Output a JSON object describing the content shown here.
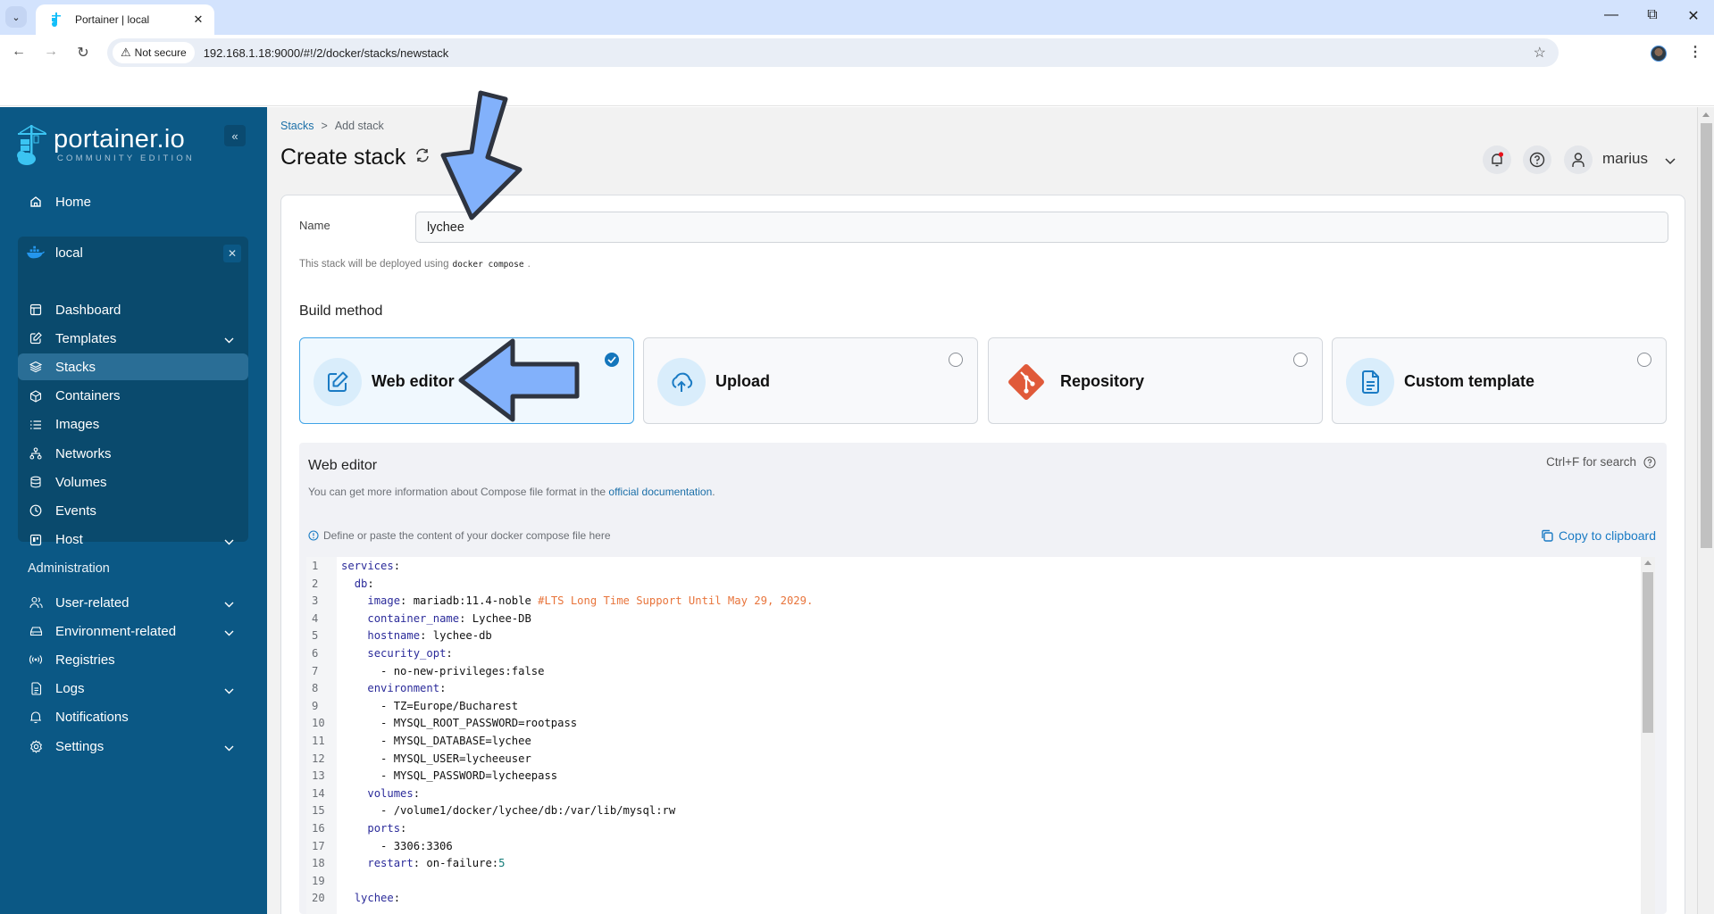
{
  "browser": {
    "tab_title": "Portainer | local",
    "security_label": "Not secure",
    "url": "192.168.1.18:9000/#!/2/docker/stacks/newstack"
  },
  "sidebar": {
    "logo_title": "portainer.io",
    "logo_subtitle": "COMMUNITY EDITION",
    "home_label": "Home",
    "environment": {
      "name": "local",
      "items": [
        {
          "label": "Dashboard",
          "icon": "dashboard-icon",
          "expandable": false,
          "active": false
        },
        {
          "label": "Templates",
          "icon": "edit-icon",
          "expandable": true,
          "active": false
        },
        {
          "label": "Stacks",
          "icon": "layers-icon",
          "expandable": false,
          "active": true
        },
        {
          "label": "Containers",
          "icon": "box-icon",
          "expandable": false,
          "active": false
        },
        {
          "label": "Images",
          "icon": "list-icon",
          "expandable": false,
          "active": false
        },
        {
          "label": "Networks",
          "icon": "network-icon",
          "expandable": false,
          "active": false
        },
        {
          "label": "Volumes",
          "icon": "database-icon",
          "expandable": false,
          "active": false
        },
        {
          "label": "Events",
          "icon": "clock-icon",
          "expandable": false,
          "active": false
        },
        {
          "label": "Host",
          "icon": "host-icon",
          "expandable": true,
          "active": false
        }
      ]
    },
    "admin_title": "Administration",
    "admin_items": [
      {
        "label": "User-related",
        "icon": "users-icon",
        "expandable": true
      },
      {
        "label": "Environment-related",
        "icon": "drive-icon",
        "expandable": true
      },
      {
        "label": "Registries",
        "icon": "radio-icon",
        "expandable": false
      },
      {
        "label": "Logs",
        "icon": "file-icon",
        "expandable": true
      },
      {
        "label": "Notifications",
        "icon": "bell-icon",
        "expandable": false
      },
      {
        "label": "Settings",
        "icon": "gear-icon",
        "expandable": true
      }
    ]
  },
  "header": {
    "breadcrumb": [
      "Stacks",
      "Add stack"
    ],
    "breadcrumb_sep": ">",
    "title": "Create stack",
    "user": "marius",
    "has_notification": true
  },
  "form": {
    "name_label": "Name",
    "name_value": "lychee",
    "deploy_note_prefix": "This stack will be deployed using",
    "deploy_note_code": "docker compose",
    "deploy_note_suffix": ".",
    "build_method_title": "Build method",
    "build_methods": [
      {
        "label": "Web editor",
        "icon": "edit-icon",
        "selected": true
      },
      {
        "label": "Upload",
        "icon": "upload-cloud-icon",
        "selected": false
      },
      {
        "label": "Repository",
        "icon": "git-icon",
        "selected": false
      },
      {
        "label": "Custom template",
        "icon": "file-text-icon",
        "selected": false
      }
    ]
  },
  "editor": {
    "title": "Web editor",
    "search_hint": "Ctrl+F for search",
    "info_prefix": "You can get more information about Compose file format in the ",
    "info_link": "official documentation",
    "info_suffix": ".",
    "define_hint": "Define or paste the content of your docker compose file here",
    "copy_label": "Copy to clipboard",
    "lines": [
      [
        {
          "t": "services",
          "c": "k"
        },
        {
          "t": ":"
        }
      ],
      [
        {
          "t": "  "
        },
        {
          "t": "db",
          "c": "k"
        },
        {
          "t": ":"
        }
      ],
      [
        {
          "t": "    "
        },
        {
          "t": "image",
          "c": "k"
        },
        {
          "t": ": mariadb:11.4-noble "
        },
        {
          "t": "#LTS Long Time Support Until May 29, 2029.",
          "c": "cm"
        }
      ],
      [
        {
          "t": "    "
        },
        {
          "t": "container_name",
          "c": "k"
        },
        {
          "t": ": Lychee-DB"
        }
      ],
      [
        {
          "t": "    "
        },
        {
          "t": "hostname",
          "c": "k"
        },
        {
          "t": ": lychee-db"
        }
      ],
      [
        {
          "t": "    "
        },
        {
          "t": "security_opt",
          "c": "k"
        },
        {
          "t": ":"
        }
      ],
      [
        {
          "t": "      - no-new-privileges:false"
        }
      ],
      [
        {
          "t": "    "
        },
        {
          "t": "environment",
          "c": "k"
        },
        {
          "t": ":"
        }
      ],
      [
        {
          "t": "      - TZ=Europe/Bucharest"
        }
      ],
      [
        {
          "t": "      - MYSQL_ROOT_PASSWORD=rootpass"
        }
      ],
      [
        {
          "t": "      - MYSQL_DATABASE=lychee"
        }
      ],
      [
        {
          "t": "      - MYSQL_USER=lycheeuser"
        }
      ],
      [
        {
          "t": "      - MYSQL_PASSWORD=lycheepass"
        }
      ],
      [
        {
          "t": "    "
        },
        {
          "t": "volumes",
          "c": "k"
        },
        {
          "t": ":"
        }
      ],
      [
        {
          "t": "      - /volume1/docker/lychee/db:/var/lib/mysql:rw"
        }
      ],
      [
        {
          "t": "    "
        },
        {
          "t": "ports",
          "c": "k"
        },
        {
          "t": ":"
        }
      ],
      [
        {
          "t": "      - 3306:3306"
        }
      ],
      [
        {
          "t": "    "
        },
        {
          "t": "restart",
          "c": "k"
        },
        {
          "t": ": on-failure:"
        },
        {
          "t": "5",
          "c": "num"
        }
      ],
      [
        {
          "t": ""
        }
      ],
      [
        {
          "t": "  "
        },
        {
          "t": "lychee",
          "c": "k"
        },
        {
          "t": ":"
        }
      ]
    ]
  },
  "colors": {
    "sidebar_bg": "#0b5885",
    "accent": "#1476bc",
    "git_orange": "#e05a3a",
    "comment": "#e8743b"
  }
}
